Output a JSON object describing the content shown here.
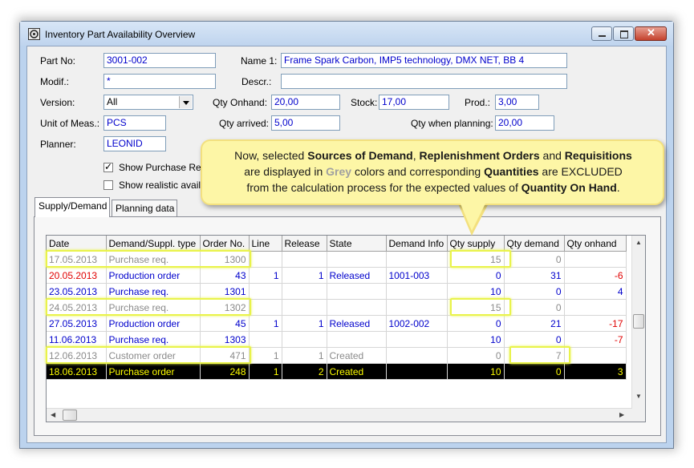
{
  "window": {
    "title": "Inventory Part Availability Overview"
  },
  "form": {
    "part_no_label": "Part No:",
    "part_no": "3001-002",
    "name1_label": "Name 1:",
    "name1": "Frame Spark Carbon, IMP5 technology, DMX NET, BB 4",
    "modif_label": "Modif.:",
    "modif": "*",
    "descr_label": "Descr.:",
    "descr": "",
    "version_label": "Version:",
    "version": "All",
    "qty_onhand_label": "Qty Onhand:",
    "qty_onhand": "20,00",
    "stock_label": "Stock:",
    "stock": "17,00",
    "prod_label": "Prod.:",
    "prod": "3,00",
    "uom_label": "Unit of Meas.:",
    "uom": "PCS",
    "qty_arrived_label": "Qty arrived:",
    "qty_arrived": "5,00",
    "qty_planning_label": "Qty when planning:",
    "qty_planning": "20,00",
    "planner_label": "Planner:",
    "planner": "LEONID",
    "show_purchase_label": "Show Purchase Re",
    "show_purchase_checked": true,
    "show_realistic_label": "Show realistic availa",
    "show_realistic_checked": false
  },
  "tabs": [
    "Supply/Demand",
    "Planning data"
  ],
  "grid": {
    "columns": [
      "Date",
      "Demand/Suppl. type",
      "Order No.",
      "Line",
      "Release",
      "State",
      "Demand Info",
      "Qty supply",
      "Qty demand",
      "Qty onhand"
    ],
    "rows": [
      {
        "style": "grey",
        "date": "17.05.2013",
        "type": "Purchase req.",
        "order": "1300",
        "line": "",
        "release": "",
        "state": "",
        "info": "",
        "supply": "15",
        "demand": "0",
        "onhand": ""
      },
      {
        "style": "blue",
        "date": "20.05.2013",
        "type": "Production order",
        "order": "43",
        "line": "1",
        "release": "1",
        "state": "Released",
        "info": "1001-003",
        "supply": "0",
        "demand": "31",
        "onhand": "-6"
      },
      {
        "style": "blue",
        "date": "23.05.2013",
        "type": "Purchase req.",
        "order": "1301",
        "line": "",
        "release": "",
        "state": "",
        "info": "",
        "supply": "10",
        "demand": "0",
        "onhand": "4"
      },
      {
        "style": "grey",
        "date": "24.05.2013",
        "type": "Purchase req.",
        "order": "1302",
        "line": "",
        "release": "",
        "state": "",
        "info": "",
        "supply": "15",
        "demand": "0",
        "onhand": ""
      },
      {
        "style": "blue",
        "date": "27.05.2013",
        "type": "Production order",
        "order": "45",
        "line": "1",
        "release": "1",
        "state": "Released",
        "info": "1002-002",
        "supply": "0",
        "demand": "21",
        "onhand": "-17"
      },
      {
        "style": "blue",
        "date": "11.06.2013",
        "type": "Purchase req.",
        "order": "1303",
        "line": "",
        "release": "",
        "state": "",
        "info": "",
        "supply": "10",
        "demand": "0",
        "onhand": "-7"
      },
      {
        "style": "grey",
        "date": "12.06.2013",
        "type": "Customer order",
        "order": "471",
        "line": "1",
        "release": "1",
        "state": "Created",
        "info": "",
        "supply": "0",
        "demand": "7",
        "onhand": ""
      },
      {
        "style": "sel",
        "date": "18.06.2013",
        "type": "Purchase order",
        "order": "248",
        "line": "1",
        "release": "2",
        "state": "Created",
        "info": "",
        "supply": "10",
        "demand": "0",
        "onhand": "3"
      }
    ]
  },
  "callout": {
    "t1": "Now, selected ",
    "b1": "Sources of Demand",
    "t2": ", ",
    "b2": "Replenishment Orders",
    "t3": " and ",
    "b3": "Requisitions",
    "t4": "are displayed in ",
    "g1": "Grey",
    "t5": " colors and corresponding ",
    "b4": "Quantities",
    "t6": " are EXCLUDED",
    "t7": "from the calculation process for the expected values of ",
    "b5": "Quantity On Hand",
    "t8": "."
  },
  "colors": {
    "value_blue": "#0000cc",
    "negative_red": "#e00000",
    "excluded_grey": "#8a8a8a",
    "highlight": "#e9f34a",
    "callout_bg": "#fdf6a6"
  }
}
